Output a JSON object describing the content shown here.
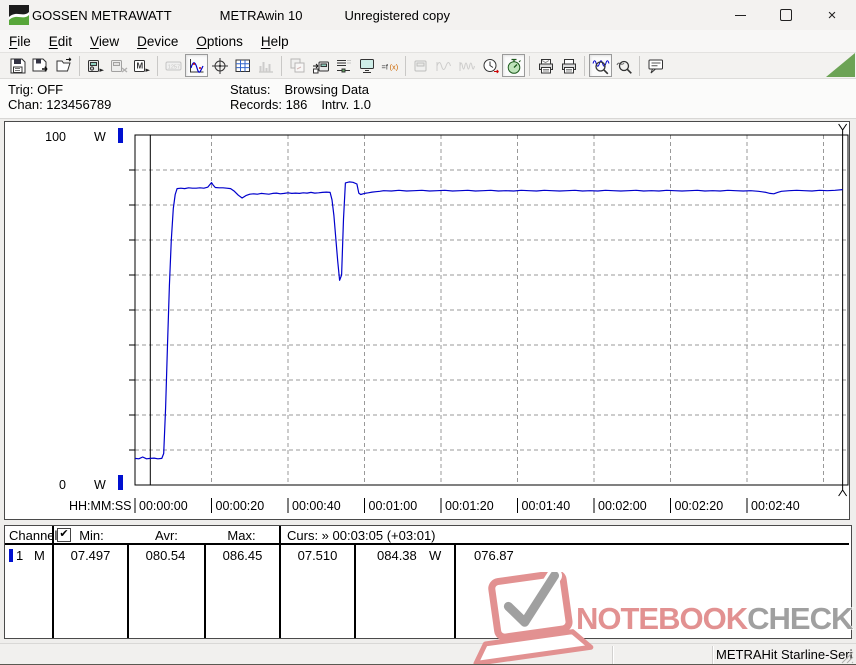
{
  "window": {
    "brand": "GOSSEN METRAWATT",
    "app": "METRAwin 10",
    "unregistered": "Unregistered copy"
  },
  "menu": {
    "items": [
      {
        "first": "F",
        "rest": "ile"
      },
      {
        "first": "E",
        "rest": "dit"
      },
      {
        "first": "V",
        "rest": "iew"
      },
      {
        "first": "D",
        "rest": "evice"
      },
      {
        "first": "O",
        "rest": "ptions"
      },
      {
        "first": "H",
        "rest": "elp"
      }
    ]
  },
  "toolbar": {
    "icons": [
      "save-data-icon",
      "save-export-icon",
      "open-file-icon",
      "device-read-icon",
      "device-disconnect-icon",
      "memory-read-icon",
      "numeric-display-icon",
      "chart-view-icon",
      "cursor-crosshair-icon",
      "table-view-icon",
      "histogram-view-icon",
      "copy-data-icon",
      "save-to-device-icon",
      "channel-list-icon",
      "monitor-view-icon",
      "formula-icon",
      "display-config-icon",
      "wave-single-icon",
      "wave-dense-icon",
      "time-sync-icon",
      "interval-timer-icon",
      "print-report-icon",
      "print-icon",
      "zoom-time-icon",
      "zoom-curve-icon",
      "annotation-icon"
    ],
    "selected": [
      "chart-view-icon",
      "interval-timer-icon",
      "zoom-time-icon"
    ]
  },
  "status_panel": {
    "trig": "Trig: OFF",
    "chan": "Chan: 123456789",
    "status_label": "Status:",
    "status_value": "Browsing Data",
    "records": "Records: 186",
    "interval": "Intrv. 1.0"
  },
  "chart_data": {
    "type": "line",
    "title": "",
    "ylabel_top": "100",
    "ylabel_bottom": "0",
    "unit_label": "W",
    "x_axis_label": "HH:MM:SS",
    "ylim": [
      0,
      100
    ],
    "y_gridline_step": 10,
    "x_tick_interval_s": 20,
    "grid": true,
    "line_color": "#0000cc",
    "x_ticks": [
      {
        "t": 0,
        "label": "00:00:00"
      },
      {
        "t": 20,
        "label": "00:00:20"
      },
      {
        "t": 40,
        "label": "00:00:40"
      },
      {
        "t": 60,
        "label": "00:01:00"
      },
      {
        "t": 80,
        "label": "00:01:20"
      },
      {
        "t": 100,
        "label": "00:01:40"
      },
      {
        "t": 120,
        "label": "00:02:00"
      },
      {
        "t": 140,
        "label": "00:02:20"
      },
      {
        "t": 160,
        "label": "00:02:40"
      }
    ],
    "x_gridlines_s": [
      20,
      40,
      60,
      80,
      100,
      120,
      140,
      160,
      180
    ],
    "cursors": {
      "left_s": 4,
      "right_s": 185,
      "readout": "Curs: » 00:03:05 (+03:01)"
    },
    "series": [
      {
        "name": "Channel 1 power (W)",
        "points": [
          [
            0,
            7.6
          ],
          [
            1,
            7.5
          ],
          [
            2,
            8.0
          ],
          [
            3,
            7.5
          ],
          [
            4,
            7.6
          ],
          [
            5,
            7.7
          ],
          [
            6,
            7.5
          ],
          [
            7,
            7.6
          ],
          [
            7.5,
            9
          ],
          [
            8,
            22
          ],
          [
            8.5,
            40
          ],
          [
            9,
            57
          ],
          [
            9.5,
            70
          ],
          [
            10,
            79
          ],
          [
            10.5,
            83
          ],
          [
            11,
            84.7
          ],
          [
            12,
            84.8
          ],
          [
            13,
            84.7
          ],
          [
            14,
            84.9
          ],
          [
            15,
            84.8
          ],
          [
            16,
            84.8
          ],
          [
            17,
            84.9
          ],
          [
            18,
            84.8
          ],
          [
            19,
            85.1
          ],
          [
            20,
            86.4
          ],
          [
            20.5,
            85.6
          ],
          [
            21,
            85.0
          ],
          [
            22,
            84.9
          ],
          [
            23,
            84.9
          ],
          [
            24,
            84.8
          ],
          [
            25,
            84.7
          ],
          [
            26,
            83.9
          ],
          [
            27,
            82.8
          ],
          [
            28,
            82.0
          ],
          [
            29,
            82.7
          ],
          [
            30,
            83.1
          ],
          [
            31,
            83.2
          ],
          [
            32,
            83.1
          ],
          [
            33,
            83.3
          ],
          [
            34,
            83.2
          ],
          [
            35,
            83.1
          ],
          [
            36,
            83.3
          ],
          [
            37,
            83.4
          ],
          [
            38,
            83.2
          ],
          [
            39,
            83.3
          ],
          [
            40,
            83.5
          ],
          [
            41,
            83.3
          ],
          [
            42,
            83.4
          ],
          [
            43,
            83.3
          ],
          [
            44,
            83.5
          ],
          [
            45,
            83.4
          ],
          [
            46,
            83.6
          ],
          [
            47,
            83.4
          ],
          [
            48,
            83.5
          ],
          [
            49,
            83.6
          ],
          [
            50,
            83.7
          ],
          [
            51,
            83.6
          ],
          [
            51.5,
            81.5
          ],
          [
            52,
            77.0
          ],
          [
            52.5,
            70.5
          ],
          [
            53,
            64.0
          ],
          [
            53.5,
            58.5
          ],
          [
            54,
            60.0
          ],
          [
            54.5,
            76.0
          ],
          [
            55,
            86.3
          ],
          [
            56,
            86.6
          ],
          [
            57,
            86.5
          ],
          [
            58,
            86.0
          ],
          [
            58.5,
            83.4
          ],
          [
            59,
            83.0
          ],
          [
            60,
            83.3
          ],
          [
            61,
            83.5
          ],
          [
            62,
            83.7
          ],
          [
            63,
            83.8
          ],
          [
            64,
            83.9
          ],
          [
            65,
            84.1
          ],
          [
            67,
            84.0
          ],
          [
            69,
            84.2
          ],
          [
            71,
            84.0
          ],
          [
            73,
            84.1
          ],
          [
            75,
            84.2
          ],
          [
            77,
            84.0
          ],
          [
            79,
            84.1
          ],
          [
            81,
            84.2
          ],
          [
            83,
            84.0
          ],
          [
            85,
            84.1
          ],
          [
            87,
            84.2
          ],
          [
            89,
            84.0
          ],
          [
            91,
            84.1
          ],
          [
            93,
            84.2
          ],
          [
            95,
            84.0
          ],
          [
            97,
            84.1
          ],
          [
            99,
            84.0
          ],
          [
            101,
            84.2
          ],
          [
            103,
            84.1
          ],
          [
            105,
            84.0
          ],
          [
            107,
            84.2
          ],
          [
            109,
            84.1
          ],
          [
            111,
            84.0
          ],
          [
            113,
            84.1
          ],
          [
            115,
            84.2
          ],
          [
            117,
            84.0
          ],
          [
            119,
            84.1
          ],
          [
            121,
            84.0
          ],
          [
            123,
            84.2
          ],
          [
            125,
            84.1
          ],
          [
            127,
            84.0
          ],
          [
            129,
            84.1
          ],
          [
            131,
            84.2
          ],
          [
            133,
            84.0
          ],
          [
            135,
            84.1
          ],
          [
            137,
            84.0
          ],
          [
            139,
            84.2
          ],
          [
            141,
            84.1
          ],
          [
            143,
            84.0
          ],
          [
            145,
            84.1
          ],
          [
            147,
            84.2
          ],
          [
            149,
            84.0
          ],
          [
            151,
            84.1
          ],
          [
            153,
            84.0
          ],
          [
            155,
            84.2
          ],
          [
            157,
            84.1
          ],
          [
            159,
            84.0
          ],
          [
            161,
            84.1
          ],
          [
            163,
            83.9
          ],
          [
            165,
            83.6
          ],
          [
            166,
            83.3
          ],
          [
            167,
            83.2
          ],
          [
            168,
            83.6
          ],
          [
            169,
            83.9
          ],
          [
            171,
            84.1
          ],
          [
            173,
            84.2
          ],
          [
            175,
            84.1
          ],
          [
            177,
            84.0
          ],
          [
            179,
            84.2
          ],
          [
            181,
            84.1
          ],
          [
            183,
            84.2
          ],
          [
            185,
            84.4
          ]
        ]
      }
    ]
  },
  "table": {
    "header": {
      "channel": "Channel:",
      "min": "Min:",
      "avr": "Avr:",
      "max": "Max:",
      "curs": "Curs: » 00:03:05 (+03:01)",
      "checkbox_checked": "✔"
    },
    "row": {
      "ch": "1",
      "mode": "M",
      "min": "07.497",
      "avr": "080.54",
      "max": "086.45",
      "c1": "07.510",
      "c2": "084.38",
      "c2unit": "W",
      "delta": "076.87"
    }
  },
  "watermark": {
    "part1": "NOTEBOOK",
    "part2": "CHECK"
  },
  "statusbar": {
    "device": "METRAHit Starline-Seri"
  },
  "colors": {
    "line_blue": "#0000cc",
    "marker_blue": "#0010d0",
    "grid_gray": "#999999",
    "logo_green": "#57a639",
    "toolbar_triangle_green": "#6ca355",
    "watermark_red": "#e29191",
    "watermark_gray": "#a0a0a0"
  }
}
